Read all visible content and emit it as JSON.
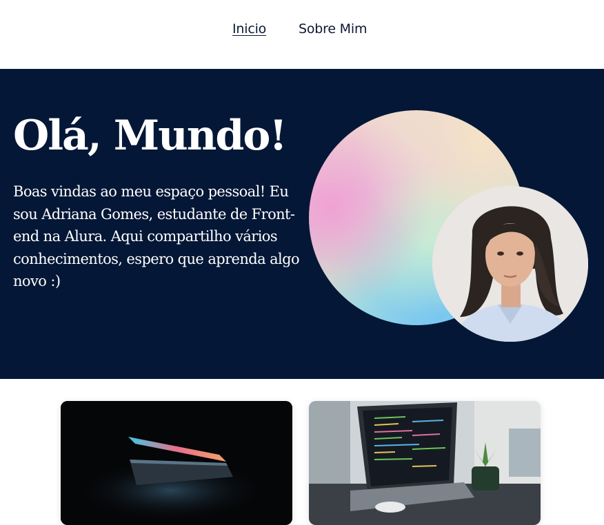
{
  "nav": {
    "items": [
      {
        "label": "Inicio",
        "active": true
      },
      {
        "label": "Sobre Mim",
        "active": false
      }
    ]
  },
  "hero": {
    "title": "Olá, Mundo!",
    "description": "Boas vindas ao meu espaço pessoal! Eu sou Adriana Gomes, estudante de Front-end na Alura. Aqui compartilho vários conhecimentos, espero que aprenda algo novo :)"
  },
  "colors": {
    "hero_background": "#041736",
    "nav_text": "#0b1733",
    "page_background": "#ffffff"
  },
  "cards": [
    {
      "image": "laptop-glowing-in-dark-photo"
    },
    {
      "image": "laptop-with-code-and-plant-photo"
    }
  ]
}
